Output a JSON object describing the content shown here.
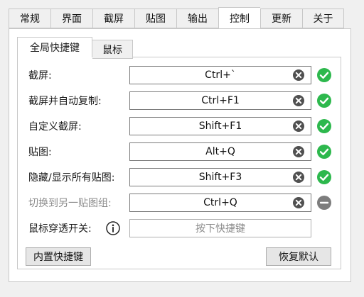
{
  "tabs": [
    {
      "label": "常规"
    },
    {
      "label": "界面"
    },
    {
      "label": "截屏"
    },
    {
      "label": "贴图"
    },
    {
      "label": "输出"
    },
    {
      "label": "控制"
    },
    {
      "label": "更新"
    },
    {
      "label": "关于"
    }
  ],
  "active_tab": "控制",
  "subtabs": [
    {
      "label": "全局快捷键"
    },
    {
      "label": "鼠标"
    }
  ],
  "hotkeys": [
    {
      "label": "截屏:",
      "value": "Ctrl+`",
      "status": "ok"
    },
    {
      "label": "截屏并自动复制:",
      "value": "Ctrl+F1",
      "status": "ok"
    },
    {
      "label": "自定义截屏:",
      "value": "Shift+F1",
      "status": "ok"
    },
    {
      "label": "贴图:",
      "value": "Alt+Q",
      "status": "ok"
    },
    {
      "label": "隐藏/显示所有贴图:",
      "value": "Shift+F3",
      "status": "ok"
    },
    {
      "label": "切换到另一贴图组:",
      "value": "Ctrl+Q",
      "status": "disabled"
    }
  ],
  "mouse_passthrough": {
    "label": "鼠标穿透开关:",
    "placeholder": "按下快捷键"
  },
  "buttons": {
    "builtin": "内置快捷键",
    "restore": "恢复默认"
  },
  "colors": {
    "ok_green": "#2db84d",
    "disabled_gray": "#7d7d7d",
    "clear_dark": "#505050"
  }
}
